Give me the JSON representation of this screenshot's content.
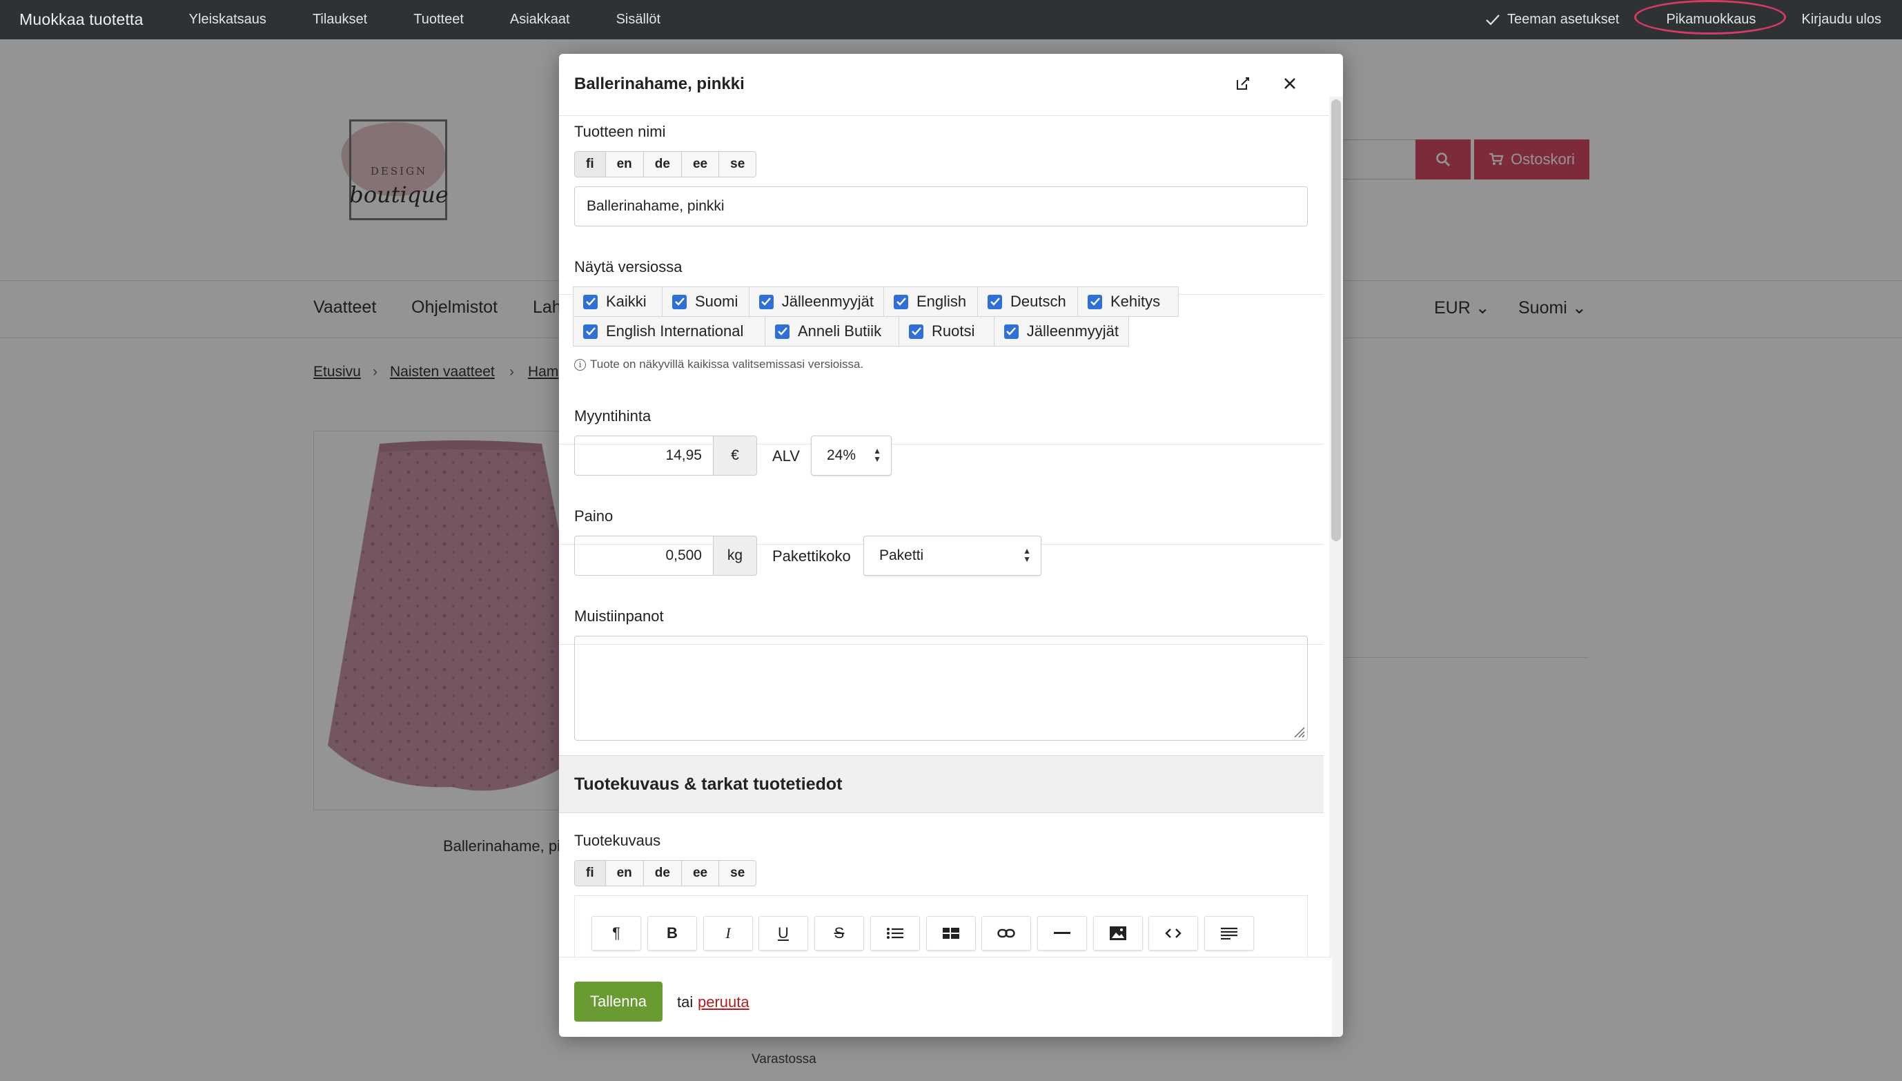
{
  "adminbar": {
    "brand": "Muokkaa tuotetta",
    "nav": [
      "Yleiskatsaus",
      "Tilaukset",
      "Tuotteet",
      "Asiakkaat",
      "Sisällöt"
    ],
    "theme_settings": "Teeman asetukset",
    "quick_edit": "Pikamuokkaus",
    "logout": "Kirjaudu ulos",
    "highlight_color": "#d63a67"
  },
  "shop": {
    "logo": {
      "line1": "DESIGN",
      "line2": "boutique"
    },
    "cart_label": "Ostoskori",
    "accent_color": "#d74a66",
    "categories": [
      "Vaatteet",
      "Ohjelmistot",
      "Lah"
    ],
    "currency": "EUR",
    "language": "Suomi",
    "breadcrumb": [
      "Etusivu",
      "Naisten vaatteet",
      "Ham"
    ],
    "product_caption": "Ballerinahame, pi",
    "stock": "Varastossa"
  },
  "modal": {
    "title": "Ballerinahame, pinkki",
    "name_label": "Tuotteen nimi",
    "languages": [
      "fi",
      "en",
      "de",
      "ee",
      "se"
    ],
    "active_language": "fi",
    "name_value": "Ballerinahame, pinkki",
    "versions_label": "Näytä versiossa",
    "versions": [
      "Kaikki",
      "Suomi",
      "Jälleenmyyjät",
      "English",
      "Deutsch",
      "Kehitys",
      "English International",
      "Anneli Butiik",
      "Ruotsi",
      "Jälleenmyyjät"
    ],
    "versions_note": "Tuote on näkyvillä kaikissa valitsemissasi versioissa.",
    "price_label": "Myyntihinta",
    "price_value": "14,95",
    "currency_unit": "€",
    "vat_label": "ALV",
    "vat_value": "24%",
    "weight_label": "Paino",
    "weight_value": "0,500",
    "weight_unit": "kg",
    "package_label": "Pakettikoko",
    "package_value": "Paketti",
    "notes_label": "Muistiinpanot",
    "notes_value": "",
    "description_section": "Tuotekuvaus & tarkat tuotetiedot",
    "description_label": "Tuotekuvaus",
    "toolbar": {
      "paragraph": "¶",
      "bold": "B",
      "italic": "I",
      "underline": "U",
      "strike": "S"
    },
    "save": "Tallenna",
    "or": "tai",
    "cancel": "peruuta",
    "checkbox_color": "#2f6fd6",
    "save_color": "#6a9a32"
  }
}
